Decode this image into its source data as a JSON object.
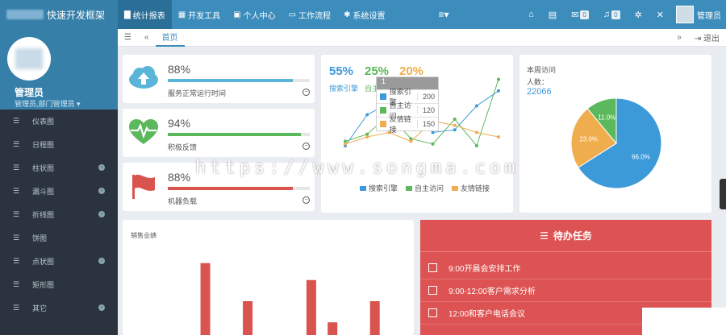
{
  "app": {
    "title": "快速开发框架"
  },
  "topnav": [
    {
      "label": "统计报表",
      "icon": "chart-icon",
      "active": true
    },
    {
      "label": "开发工具",
      "icon": "grid-icon",
      "active": false
    },
    {
      "label": "个人中心",
      "icon": "card-icon",
      "active": false
    },
    {
      "label": "工作流程",
      "icon": "monitor-icon",
      "active": false
    },
    {
      "label": "系统设置",
      "icon": "gear-icon",
      "active": false
    }
  ],
  "topright": {
    "mail_badge": "0",
    "bell_badge": "0",
    "user": "管理员"
  },
  "profile": {
    "name": "管理员",
    "role": "管理员,部门管理员"
  },
  "sidebar": [
    {
      "label": "仪表图",
      "has_children": false
    },
    {
      "label": "日程图",
      "has_children": false
    },
    {
      "label": "柱状图",
      "has_children": true
    },
    {
      "label": "漏斗图",
      "has_children": true
    },
    {
      "label": "折线图",
      "has_children": true
    },
    {
      "label": "饼图",
      "has_children": false
    },
    {
      "label": "点状图",
      "has_children": true
    },
    {
      "label": "矩形图",
      "has_children": false
    },
    {
      "label": "其它",
      "has_children": true
    }
  ],
  "tabs": {
    "home": "首页",
    "exit": "退出"
  },
  "stats": [
    {
      "pct": "88%",
      "value": 0.88,
      "label": "服务正常运行时间",
      "color": "#5bb5d9",
      "icon": "cloud-upload-icon"
    },
    {
      "pct": "94%",
      "value": 0.94,
      "label": "积极反馈",
      "color": "#5cb85c",
      "icon": "heart-pulse-icon"
    },
    {
      "pct": "88%",
      "value": 0.88,
      "label": "机器负载",
      "color": "#d9534f",
      "icon": "flag-icon"
    }
  ],
  "traffic": {
    "pcts": [
      {
        "value": "55%",
        "label": "搜索引擎",
        "color": "#3d9ad9"
      },
      {
        "value": "25%",
        "label": "自主访问",
        "color": "#5cb85c"
      },
      {
        "value": "20%",
        "label": "友情链接",
        "color": "#f0ad4e"
      }
    ],
    "tooltip": {
      "header": "1",
      "rows": [
        {
          "label": "搜索引擎",
          "value": "200",
          "color": "#3d9ad9"
        },
        {
          "label": "自主访问",
          "value": "120",
          "color": "#5cb85c"
        },
        {
          "label": "友情链接",
          "value": "150",
          "color": "#f0ad4e"
        }
      ]
    }
  },
  "visits": {
    "title": "本周访问",
    "subtitle": "人数：",
    "count": "22066"
  },
  "sales": {
    "title": "销售业绩"
  },
  "todo": {
    "title": "待办任务",
    "items": [
      "9:00开晨会安排工作",
      "9:00-12:00客户需求分析",
      "12:00和客户电话会议"
    ]
  },
  "watermark": "https://www.songma.com",
  "chart_data": [
    {
      "type": "line",
      "series": [
        {
          "name": "搜索引擎",
          "color": "#3d9ad9",
          "values": [
            0.2,
            0.55,
            0.68,
            0.8,
            0.35,
            0.38,
            0.65,
            0.82
          ]
        },
        {
          "name": "自主访问",
          "color": "#5cb85c",
          "values": [
            0.25,
            0.33,
            0.55,
            0.28,
            0.22,
            0.5,
            0.2,
            0.95
          ]
        },
        {
          "name": "友情链接",
          "color": "#f0ad4e",
          "values": [
            0.22,
            0.3,
            0.35,
            0.25,
            0.48,
            0.43,
            0.35,
            0.3
          ]
        }
      ]
    },
    {
      "type": "pie",
      "slices": [
        {
          "label": "66.0%",
          "value": 66.0,
          "color": "#3d9ad9"
        },
        {
          "label": "23.0%",
          "value": 23.0,
          "color": "#f0ad4e"
        },
        {
          "label": "11.0%",
          "value": 11.0,
          "color": "#5cb85c"
        }
      ]
    },
    {
      "type": "bar",
      "title": "销售业绩",
      "color": "#d9534f",
      "values": [
        0,
        0,
        0.85,
        0,
        0.4,
        0,
        0,
        0.65,
        0.15,
        0,
        0.4
      ]
    }
  ]
}
